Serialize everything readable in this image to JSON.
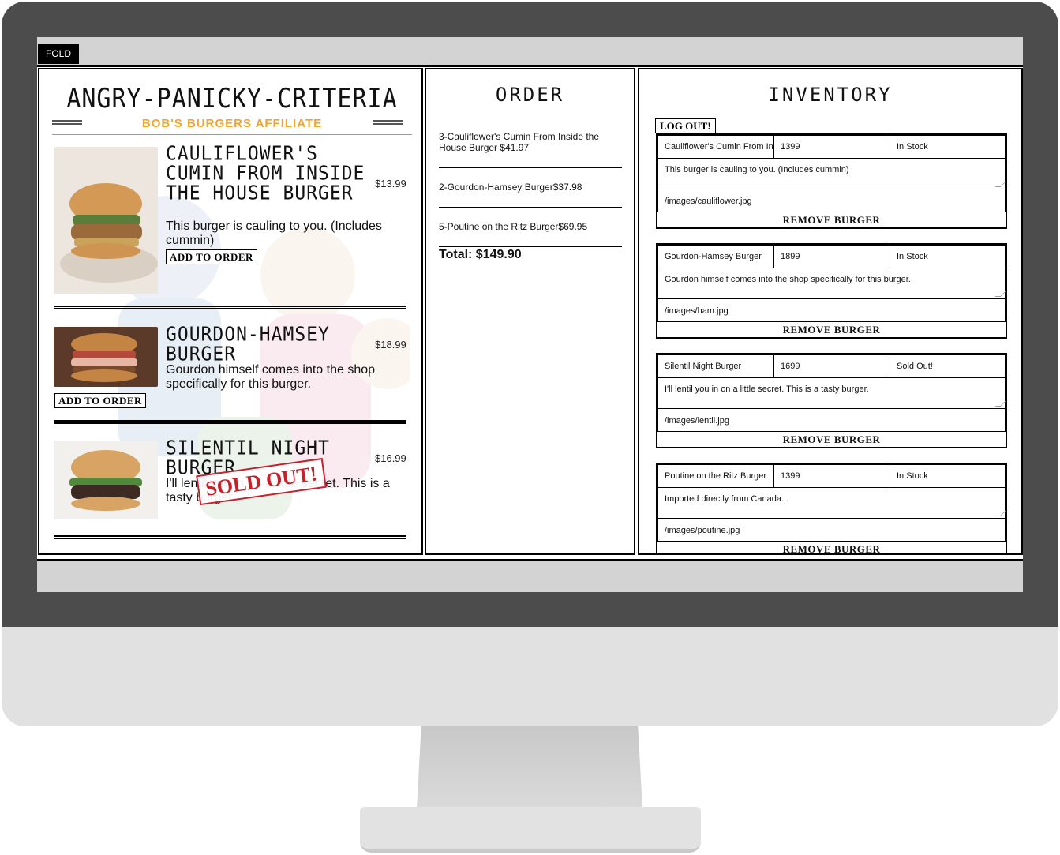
{
  "fold_label": "FOLD",
  "menu": {
    "logo_title": "ANGRY-PANICKY-CRITERIA",
    "logo_subtitle": "BOB'S BURGERS AFFILIATE",
    "add_label": "ADD TO ORDER",
    "sold_out_label": "SOLD OUT!",
    "items": [
      {
        "name": "CAULIFLOWER'S CUMIN FROM INSIDE THE HOUSE BURGER",
        "price": "$13.99",
        "desc": "This burger is cauling to you. (Includes cummin)"
      },
      {
        "name": "GOURDON-HAMSEY BURGER",
        "price": "$18.99",
        "desc": "Gourdon himself comes into the shop specifically for this burger."
      },
      {
        "name": "SILENTIL NIGHT BURGER",
        "price": "$16.99",
        "desc": "I'll lentil you in on a little secret. This is a tasty burger."
      }
    ]
  },
  "order": {
    "title": "ORDER",
    "items": [
      "3-Cauliflower's Cumin From Inside the House Burger $41.97",
      "2-Gourdon-Hamsey Burger$37.98",
      "5-Poutine on the Ritz Burger$69.95"
    ],
    "total": "Total: $149.90"
  },
  "inventory": {
    "title": "INVENTORY",
    "logout_label": "LOG OUT!",
    "remove_label": "REMOVE BURGER",
    "items": [
      {
        "name": "Cauliflower's Cumin From In",
        "price": "1399",
        "status": "In Stock",
        "desc": "This burger is cauling to you. (Includes cummin)",
        "image": "/images/cauliflower.jpg"
      },
      {
        "name": "Gourdon-Hamsey Burger",
        "price": "1899",
        "status": "In Stock",
        "desc": "Gourdon himself comes into the shop specifically for this burger.",
        "image": "/images/ham.jpg"
      },
      {
        "name": "Silentil Night Burger",
        "price": "1699",
        "status": "Sold Out!",
        "desc": "I'll lentil you in on a little secret. This is a tasty burger.",
        "image": "/images/lentil.jpg"
      },
      {
        "name": "Poutine on the Ritz Burger",
        "price": "1399",
        "status": "In Stock",
        "desc": "Imported directly from Canada...",
        "image": "/images/poutine.jpg"
      }
    ]
  },
  "colors": {
    "bezel": "#4c4c4c",
    "accent_orange": "#f3a52b",
    "sold_out_red": "#c8202a"
  }
}
